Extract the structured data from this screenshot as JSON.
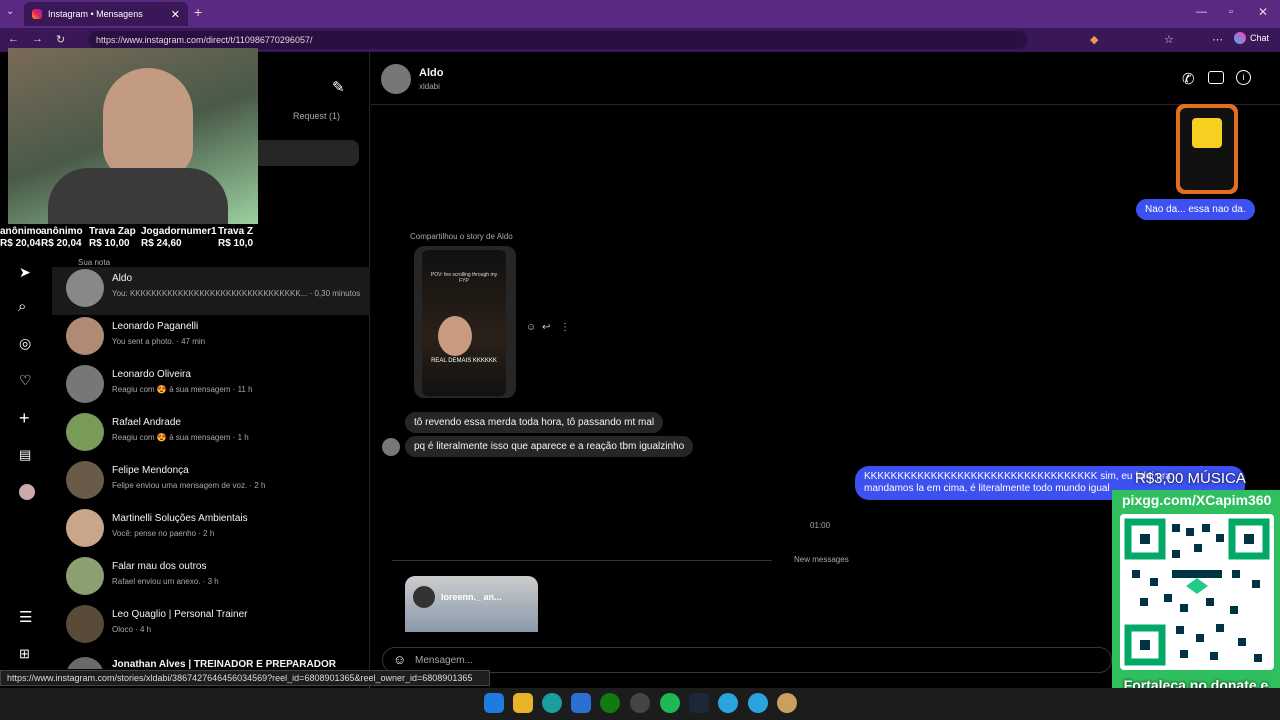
{
  "browser": {
    "tab_title": "Instagram • Mensagens",
    "url": "https://www.instagram.com/direct/t/110986770296057/",
    "chat_label": "Chat",
    "status_url": "https://www.instagram.com/stories/xldabi/3867427646456034569?reel_id=6808901365&reel_owner_id=6808901365"
  },
  "sidebar": {
    "request_label": "Request (1)",
    "note_label": "Sua nota",
    "conversations": [
      {
        "name": "Aldo",
        "preview": "You: KKKKKKKKKKKKKKKKKKKKKKKKKKKKKKKK... · 0,30 minutos"
      },
      {
        "name": "Leonardo Paganelli",
        "preview": "You sent a photo. · 47 min"
      },
      {
        "name": "Leonardo Oliveira",
        "preview": "Reagiu com 😍 à sua mensagem · 11 h"
      },
      {
        "name": "Rafael Andrade",
        "preview": "Reagiu com 😍 à sua mensagem · 1 h"
      },
      {
        "name": "Felipe Mendonça",
        "preview": "Felipe enviou uma mensagem de voz. · 2 h"
      },
      {
        "name": "Martinelli Soluções Ambientais",
        "preview": "Você: pense no paenho · 2 h"
      },
      {
        "name": "Falar mau dos outros",
        "preview": "Rafael enviou um anexo. · 3 h"
      },
      {
        "name": "Leo Quaglio | Personal Trainer",
        "preview": "Oloco · 4 h"
      },
      {
        "name": "Jonathan Alves | TREINADOR E PREPARADOR FÍSICO",
        "preview": ""
      }
    ]
  },
  "chat": {
    "name": "Aldo",
    "username": "xldabi",
    "story_label": "Compartilhou o story de Aldo",
    "story_text_top": "POV: fee scrolling through my FYP",
    "story_text_bottom": "REAL DEMAIS KKKKKK",
    "msg_out_1": "Nao da... essa nao da.",
    "msg_in_1": "tô revendo essa merda toda hora, tô passando mt mal",
    "msg_in_2": "pq é literalmente isso que aparece e a reação tbm igualzinho",
    "msg_out_2_line1": "KKKKKKKKKKKKKKKKKKKKKKKKKKKKKKKKKKK sim, eu falei pra ",
    "msg_out_2_line2": "mandamos la em cima, é literalmente todo mundo igual",
    "time": "01:00",
    "new_messages": "New messages",
    "reel_user": "loreenn._ an...",
    "composer_placeholder": "Mensagem..."
  },
  "overlay": {
    "donors": [
      {
        "name": "anônimo",
        "amount": "R$ 20,04"
      },
      {
        "name": "anônimo",
        "amount": "R$ 20,04"
      },
      {
        "name": "Trava Zap",
        "amount": "R$ 10,00"
      },
      {
        "name": "Jogadornumer1",
        "amount": "R$ 24,60"
      },
      {
        "name": "Trava Z",
        "amount": "R$ 10,0"
      }
    ],
    "music_price": "R$3,00 MÚSICA",
    "pix_link": "pixgg.com/XCapim360",
    "donate_text": "Fortaleça no donate e envie sua mensagem!"
  }
}
